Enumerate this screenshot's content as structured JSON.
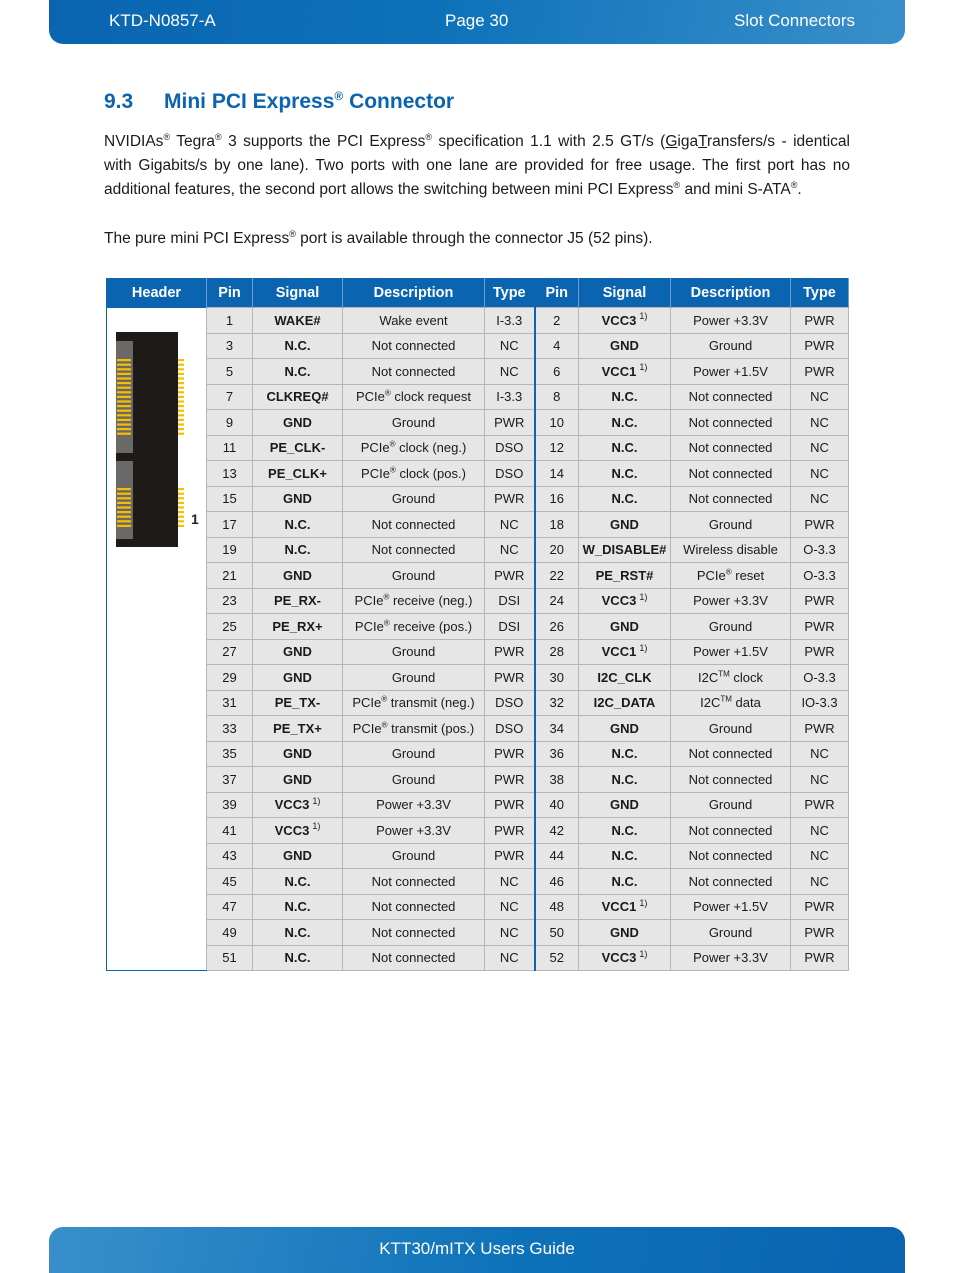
{
  "header": {
    "doc_id": "KTD-N0857-A",
    "page": "Page 30",
    "section": "Slot Connectors"
  },
  "footer": {
    "title": "KTT30/mITX Users Guide"
  },
  "section": {
    "number": "9.3",
    "title_pre": "Mini PCI Express",
    "title_reg": "®",
    "title_post": " Connector"
  },
  "paragraphs": {
    "p1": {
      "t1": "NVIDIAs",
      "reg": "®",
      "t2": " Tegra",
      "t3": " 3 supports the PCI Express",
      "t4": " specification 1.1 with 2.5 GT/s (",
      "g": "G",
      "iga": "iga",
      "tt": "T",
      "t5": "ransfers/s - identical with Gigabits/s by one lane). Two ports with one lane are provided for free usage. The first port has no additional features, the second port allows the switching between mini PCI Express",
      "t6": " and mini S-ATA",
      "t7": "."
    },
    "p2": {
      "t1": "The pure mini PCI Express",
      "reg": "®",
      "t2": " port is available through the connector J5 (52 pins)."
    }
  },
  "table": {
    "columns": [
      "Header",
      "Pin",
      "Signal",
      "Description",
      "Type",
      "Pin",
      "Signal",
      "Description",
      "Type"
    ],
    "connector_pin1_label": "1",
    "rows": [
      {
        "lp": "1",
        "ls": "WAKE#",
        "lf": "",
        "ld": "Wake event",
        "lt": "I-3.3",
        "rp": "2",
        "rs": "VCC3",
        "rf": "1)",
        "rd": "Power +3.3V",
        "rt": "PWR"
      },
      {
        "lp": "3",
        "ls": "N.C.",
        "lf": "",
        "ld": "Not connected",
        "lt": "NC",
        "rp": "4",
        "rs": "GND",
        "rf": "",
        "rd": "Ground",
        "rt": "PWR"
      },
      {
        "lp": "5",
        "ls": "N.C.",
        "lf": "",
        "ld": "Not connected",
        "lt": "NC",
        "rp": "6",
        "rs": "VCC1",
        "rf": "1)",
        "rd": "Power +1.5V",
        "rt": "PWR"
      },
      {
        "lp": "7",
        "ls": "CLKREQ#",
        "lf": "",
        "ld": "PCIe® clock request",
        "lt": "I-3.3",
        "rp": "8",
        "rs": "N.C.",
        "rf": "",
        "rd": "Not connected",
        "rt": "NC"
      },
      {
        "lp": "9",
        "ls": "GND",
        "lf": "",
        "ld": "Ground",
        "lt": "PWR",
        "rp": "10",
        "rs": "N.C.",
        "rf": "",
        "rd": "Not connected",
        "rt": "NC"
      },
      {
        "lp": "11",
        "ls": "PE_CLK-",
        "lf": "",
        "ld": "PCIe® clock (neg.)",
        "lt": "DSO",
        "rp": "12",
        "rs": "N.C.",
        "rf": "",
        "rd": "Not connected",
        "rt": "NC"
      },
      {
        "lp": "13",
        "ls": "PE_CLK+",
        "lf": "",
        "ld": "PCIe® clock (pos.)",
        "lt": "DSO",
        "rp": "14",
        "rs": "N.C.",
        "rf": "",
        "rd": "Not connected",
        "rt": "NC"
      },
      {
        "lp": "15",
        "ls": "GND",
        "lf": "",
        "ld": "Ground",
        "lt": "PWR",
        "rp": "16",
        "rs": "N.C.",
        "rf": "",
        "rd": "Not connected",
        "rt": "NC"
      },
      {
        "lp": "17",
        "ls": "N.C.",
        "lf": "",
        "ld": "Not connected",
        "lt": "NC",
        "rp": "18",
        "rs": "GND",
        "rf": "",
        "rd": "Ground",
        "rt": "PWR"
      },
      {
        "lp": "19",
        "ls": "N.C.",
        "lf": "",
        "ld": "Not connected",
        "lt": "NC",
        "rp": "20",
        "rs": "W_DISABLE#",
        "rf": "",
        "rd": "Wireless disable",
        "rt": "O-3.3"
      },
      {
        "lp": "21",
        "ls": "GND",
        "lf": "",
        "ld": "Ground",
        "lt": "PWR",
        "rp": "22",
        "rs": "PE_RST#",
        "rf": "",
        "rd": "PCIe® reset",
        "rt": "O-3.3"
      },
      {
        "lp": "23",
        "ls": "PE_RX-",
        "lf": "",
        "ld": "PCIe® receive (neg.)",
        "lt": "DSI",
        "rp": "24",
        "rs": "VCC3",
        "rf": "1)",
        "rd": "Power +3.3V",
        "rt": "PWR"
      },
      {
        "lp": "25",
        "ls": "PE_RX+",
        "lf": "",
        "ld": "PCIe® receive (pos.)",
        "lt": "DSI",
        "rp": "26",
        "rs": "GND",
        "rf": "",
        "rd": "Ground",
        "rt": "PWR"
      },
      {
        "lp": "27",
        "ls": "GND",
        "lf": "",
        "ld": "Ground",
        "lt": "PWR",
        "rp": "28",
        "rs": "VCC1",
        "rf": "1)",
        "rd": "Power +1.5V",
        "rt": "PWR"
      },
      {
        "lp": "29",
        "ls": "GND",
        "lf": "",
        "ld": "Ground",
        "lt": "PWR",
        "rp": "30",
        "rs": "I2C_CLK",
        "rf": "",
        "rd": "I2C™ clock",
        "rt": "O-3.3"
      },
      {
        "lp": "31",
        "ls": "PE_TX-",
        "lf": "",
        "ld": "PCIe® transmit (neg.)",
        "lt": "DSO",
        "rp": "32",
        "rs": "I2C_DATA",
        "rf": "",
        "rd": "I2C™ data",
        "rt": "IO-3.3"
      },
      {
        "lp": "33",
        "ls": "PE_TX+",
        "lf": "",
        "ld": "PCIe® transmit (pos.)",
        "lt": "DSO",
        "rp": "34",
        "rs": "GND",
        "rf": "",
        "rd": "Ground",
        "rt": "PWR"
      },
      {
        "lp": "35",
        "ls": "GND",
        "lf": "",
        "ld": "Ground",
        "lt": "PWR",
        "rp": "36",
        "rs": "N.C.",
        "rf": "",
        "rd": "Not connected",
        "rt": "NC"
      },
      {
        "lp": "37",
        "ls": "GND",
        "lf": "",
        "ld": "Ground",
        "lt": "PWR",
        "rp": "38",
        "rs": "N.C.",
        "rf": "",
        "rd": "Not connected",
        "rt": "NC"
      },
      {
        "lp": "39",
        "ls": "VCC3",
        "lf": "1)",
        "ld": "Power +3.3V",
        "lt": "PWR",
        "rp": "40",
        "rs": "GND",
        "rf": "",
        "rd": "Ground",
        "rt": "PWR"
      },
      {
        "lp": "41",
        "ls": "VCC3",
        "lf": "1)",
        "ld": "Power +3.3V",
        "lt": "PWR",
        "rp": "42",
        "rs": "N.C.",
        "rf": "",
        "rd": "Not connected",
        "rt": "NC"
      },
      {
        "lp": "43",
        "ls": "GND",
        "lf": "",
        "ld": "Ground",
        "lt": "PWR",
        "rp": "44",
        "rs": "N.C.",
        "rf": "",
        "rd": "Not connected",
        "rt": "NC"
      },
      {
        "lp": "45",
        "ls": "N.C.",
        "lf": "",
        "ld": "Not connected",
        "lt": "NC",
        "rp": "46",
        "rs": "N.C.",
        "rf": "",
        "rd": "Not connected",
        "rt": "NC"
      },
      {
        "lp": "47",
        "ls": "N.C.",
        "lf": "",
        "ld": "Not connected",
        "lt": "NC",
        "rp": "48",
        "rs": "VCC1",
        "rf": "1)",
        "rd": "Power +1.5V",
        "rt": "PWR"
      },
      {
        "lp": "49",
        "ls": "N.C.",
        "lf": "",
        "ld": "Not connected",
        "lt": "NC",
        "rp": "50",
        "rs": "GND",
        "rf": "",
        "rd": "Ground",
        "rt": "PWR"
      },
      {
        "lp": "51",
        "ls": "N.C.",
        "lf": "",
        "ld": "Not connected",
        "lt": "NC",
        "rp": "52",
        "rs": "VCC3",
        "rf": "1)",
        "rd": "Power +3.3V",
        "rt": "PWR"
      }
    ]
  },
  "colors": {
    "brand_blue": "#0a64b0",
    "cell_bg": "#e6e6e6",
    "connector_body": "#1e1a18",
    "connector_contact": "#f5c000"
  }
}
